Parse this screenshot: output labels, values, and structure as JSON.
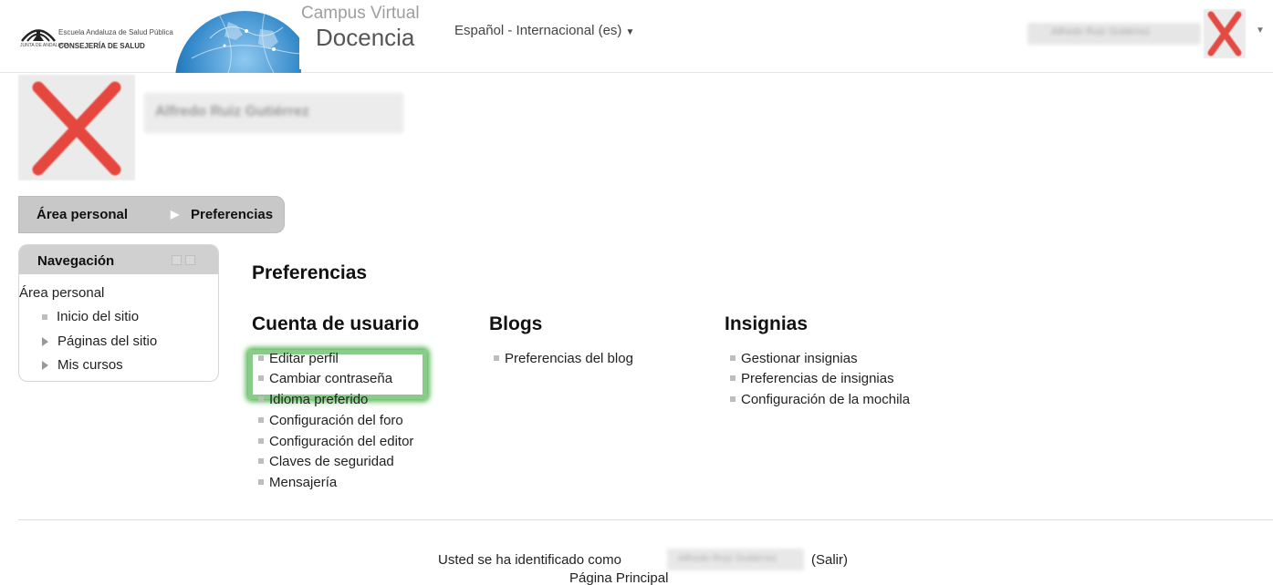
{
  "header": {
    "logo": {
      "line1": "Escuela Andaluza de Salud Pública",
      "line2": "JUNTA DE ANDALUCIA",
      "line3": "CONSEJERÍA DE SALUD"
    },
    "campus_title": "Campus Virtual",
    "campus_subtitle": "Docencia",
    "language": "Español - Internacional (es)",
    "user_name": "Alfredo Ruiz Gutiérrez"
  },
  "profile": {
    "name": "Alfredo Ruiz Gutiérrez"
  },
  "breadcrumb": {
    "items": [
      "Área personal",
      "Preferencias"
    ],
    "separator": "▶"
  },
  "navigation": {
    "title": "Navegación",
    "root": "Área personal",
    "items": [
      {
        "label": "Inicio del sitio",
        "type": "leaf"
      },
      {
        "label": "Páginas del sitio",
        "type": "expandable"
      },
      {
        "label": "Mis cursos",
        "type": "expandable"
      }
    ]
  },
  "main": {
    "title": "Preferencias",
    "sections": [
      {
        "heading": "Cuenta de usuario",
        "links": [
          "Editar perfil",
          "Cambiar contraseña",
          "Idioma preferido",
          "Configuración del foro",
          "Configuración del editor",
          "Claves de seguridad",
          "Mensajería"
        ]
      },
      {
        "heading": "Blogs",
        "links": [
          "Preferencias del blog"
        ]
      },
      {
        "heading": "Insignias",
        "links": [
          "Gestionar insignias",
          "Preferencias de insignias",
          "Configuración de la mochila"
        ]
      }
    ],
    "highlight_color": "#3caa3c"
  },
  "footer": {
    "logged_in_text": "Usted se ha identificado como",
    "user_name": "Alfredo Ruiz Gutiérrez",
    "logout": "(Salir)",
    "home": "Página Principal"
  },
  "colors": {
    "breadcrumb_bg": "#c8c8c8",
    "nav_head_bg": "#d0d0d0",
    "avatar_x": "#e0403a"
  }
}
